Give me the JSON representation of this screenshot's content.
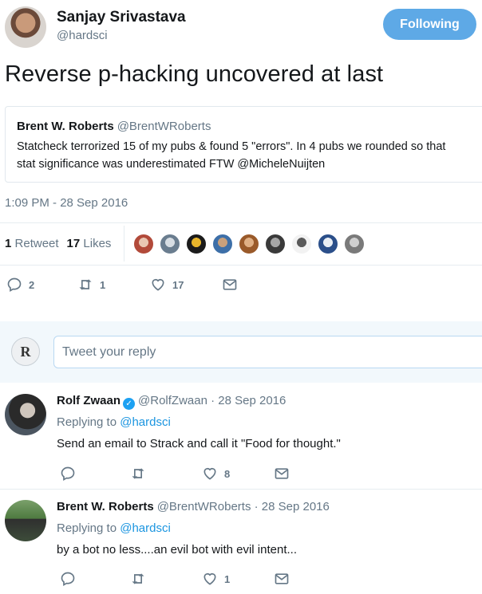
{
  "header": {
    "name": "Sanjay Srivastava",
    "handle": "@hardsci",
    "follow_label": "Following"
  },
  "tweet": {
    "text": "Reverse p-hacking uncovered at last",
    "timestamp": "1:09 PM - 28 Sep 2016"
  },
  "quote": {
    "name": "Brent W. Roberts",
    "handle": "@BrentWRoberts",
    "lines": [
      "Statcheck terrorized 15 of my pubs & found 5 \"errors\". In 4 pubs we rounded so that",
      "stat significance was underestimated FTW @MicheleNuijten"
    ]
  },
  "stats": {
    "retweet_count": "1",
    "retweet_label": "Retweet",
    "like_count": "17",
    "like_label": "Likes"
  },
  "likers": [
    {
      "colors": [
        "#b24a3a",
        "#e9c7b3"
      ]
    },
    {
      "colors": [
        "#6a7d8f",
        "#d7dde3"
      ]
    },
    {
      "colors": [
        "#1b1b1b",
        "#e8b52b"
      ]
    },
    {
      "colors": [
        "#3d6fa8",
        "#c8a07c"
      ]
    },
    {
      "colors": [
        "#9a5a2a",
        "#e0b085"
      ]
    },
    {
      "colors": [
        "#3a3a3a",
        "#a6a6a6"
      ]
    },
    {
      "colors": [
        "#f2f2f2",
        "#5a5a5a"
      ]
    },
    {
      "colors": [
        "#2b4f8a",
        "#e9eef4"
      ]
    },
    {
      "colors": [
        "#7a7a7a",
        "#d0d0d0"
      ]
    }
  ],
  "actions": {
    "reply_count": "2",
    "retweet_count": "1",
    "like_count": "17"
  },
  "composer": {
    "placeholder": "Tweet your reply",
    "avatar_letter": "R"
  },
  "replies": [
    {
      "name": "Rolf Zwaan",
      "verified": true,
      "meta": "@RolfZwaan · 28 Sep 2016",
      "replying_prefix": "Replying to",
      "replying_to": "@hardsci",
      "text": "Send an email to Strack and call it \"Food for thought.\"",
      "reply_count": "",
      "retweet_count": "",
      "like_count": "8"
    },
    {
      "name": "Brent W. Roberts",
      "verified": false,
      "meta": "@BrentWRoberts · 28 Sep 2016",
      "replying_prefix": "Replying to",
      "replying_to": "@hardsci",
      "text": "by a bot no less....an evil bot with evil intent...",
      "reply_count": "",
      "retweet_count": "",
      "like_count": "1"
    }
  ],
  "colors": {
    "accent": "#1da1f2",
    "follow_bg": "#5ea9e6",
    "muted": "#657786",
    "link": "#1b95e0"
  }
}
